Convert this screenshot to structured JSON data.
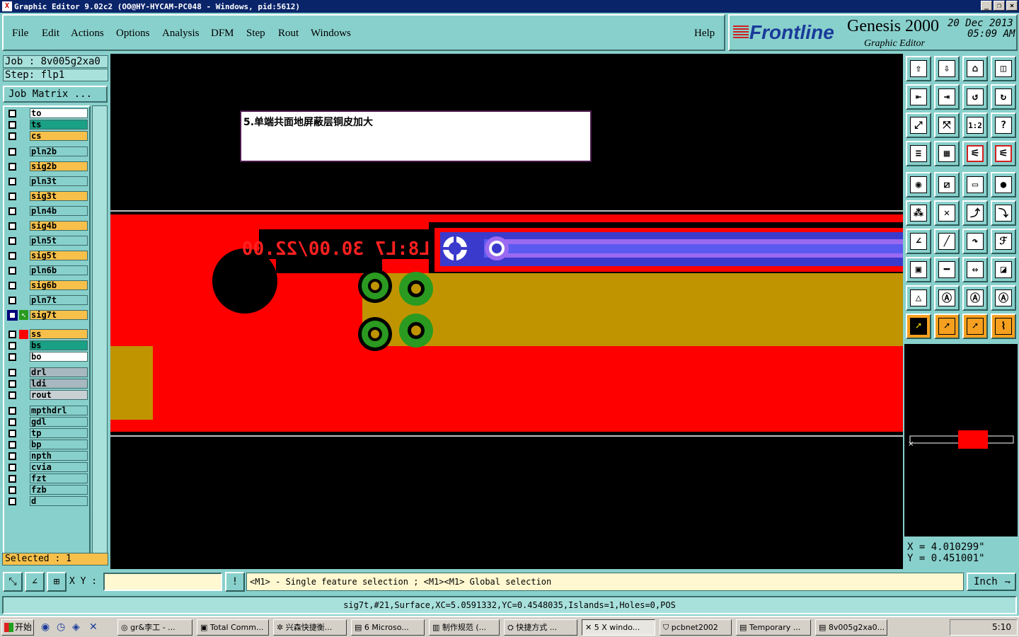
{
  "window": {
    "title": "Graphic Editor 9.02c2 (OO@HY-HYCAM-PC048 - Windows, pid:5612)",
    "controls": [
      "_",
      "❐",
      "×"
    ]
  },
  "menu": {
    "items": [
      {
        "label": "File"
      },
      {
        "label": "Edit"
      },
      {
        "label": "Actions"
      },
      {
        "label": "Options"
      },
      {
        "label": "Analysis"
      },
      {
        "label": "DFM"
      },
      {
        "label": "Step"
      },
      {
        "label": "Rout"
      },
      {
        "label": "Windows"
      }
    ],
    "help": "Help"
  },
  "brand": {
    "logo": "Frontline",
    "product": "Genesis 2000",
    "subtitle": "Graphic Editor",
    "date": "20 Dec 2013",
    "time": "05:09 AM"
  },
  "job": {
    "job_line": "Job : 8v005g2xa0",
    "step_line": "Step: flp1",
    "matrix_button": "Job Matrix ..."
  },
  "layers": [
    {
      "name": "to",
      "color": "#ffffff"
    },
    {
      "name": "ts",
      "color": "#1aa085"
    },
    {
      "name": "cs",
      "color": "#f7c04a"
    },
    {
      "name": "pln2b",
      "color": "#88d0cc"
    },
    {
      "name": "sig2b",
      "color": "#f7c04a"
    },
    {
      "name": "pln3t",
      "color": "#88d0cc"
    },
    {
      "name": "sig3t",
      "color": "#f7c04a"
    },
    {
      "name": "pln4b",
      "color": "#88d0cc"
    },
    {
      "name": "sig4b",
      "color": "#f7c04a"
    },
    {
      "name": "pln5t",
      "color": "#88d0cc"
    },
    {
      "name": "sig5t",
      "color": "#f7c04a"
    },
    {
      "name": "pln6b",
      "color": "#88d0cc"
    },
    {
      "name": "sig6b",
      "color": "#f7c04a"
    },
    {
      "name": "pln7t",
      "color": "#88d0cc"
    },
    {
      "name": "sig7t",
      "color": "#f7c04a"
    },
    {
      "name": "ss",
      "color": "#f7c04a"
    },
    {
      "name": "bs",
      "color": "#1aa085"
    },
    {
      "name": "bo",
      "color": "#ffffff"
    },
    {
      "name": "drl",
      "color": "#a8b8c0"
    },
    {
      "name": "ldi",
      "color": "#a8b8c0"
    },
    {
      "name": "rout",
      "color": "#c8d0d4"
    },
    {
      "name": "mpthdrl",
      "color": "#88d0cc"
    },
    {
      "name": "gdl",
      "color": "#88d0cc"
    },
    {
      "name": "tp",
      "color": "#88d0cc"
    },
    {
      "name": "bp",
      "color": "#88d0cc"
    },
    {
      "name": "npth",
      "color": "#88d0cc"
    },
    {
      "name": "cvia",
      "color": "#88d0cc"
    },
    {
      "name": "fzt",
      "color": "#88d0cc"
    },
    {
      "name": "fzb",
      "color": "#88d0cc"
    },
    {
      "name": "d",
      "color": "#88d0cc"
    }
  ],
  "selected_text": "Selected : 1",
  "canvas": {
    "note": "5.单端共面地屏蔽层铜皮加大",
    "mirrored_label": "L8:L7 30.00/22.00"
  },
  "tools": [
    "snap-icon",
    "zoom-fit-icon",
    "home-icon",
    "window-icon",
    "pan-left-icon",
    "pan-right-icon",
    "undo-icon",
    "redraw-icon",
    "zoom-in-icon",
    "zoom-out-icon",
    "scale-1-2-icon",
    "help-icon",
    "settings-icon",
    "grid-icon",
    "layers-red-icon",
    "layers-black-icon",
    "feature-select-icon",
    "net-select-icon",
    "ruler-icon",
    "pad-icon",
    "connect-icon",
    "cross-icon",
    "move-icon",
    "copy-icon",
    "line-angle-icon",
    "line-icon",
    "arc-icon",
    "text-icon",
    "add-pad-icon",
    "split-icon",
    "measure-icon",
    "combine-icon",
    "triangle-icon",
    "arrow-up-icon",
    "arrow-a-icon",
    "arrow-b-icon",
    "pointer-icon",
    "select-pointer-icon",
    "net-pointer-icon",
    "route-icon"
  ],
  "tool_scale_label": "1:2",
  "coords": {
    "x": "X = 4.010299\"",
    "y": "Y = 0.451001\""
  },
  "cmdbar": {
    "xy_label": "X Y :",
    "xy_value": "",
    "prompt": "<M1> - Single feature selection ; <M1><M1> Global selection",
    "unit": "Inch"
  },
  "status": "sig7t,#21,Surface,XC=5.0591332,YC=0.4548035,Islands=1,Holes=0,POS",
  "taskbar": {
    "start": "开始",
    "tasks": [
      "gr&李工 - ...",
      "Total Comm...",
      "兴森快捷衡...",
      "6 Microso...",
      "制作规范 (...",
      "快捷方式 ...",
      "5 X windo...",
      "pcbnet2002",
      "Temporary ...",
      "8v005g2xa0..."
    ],
    "clock": "5:10"
  }
}
